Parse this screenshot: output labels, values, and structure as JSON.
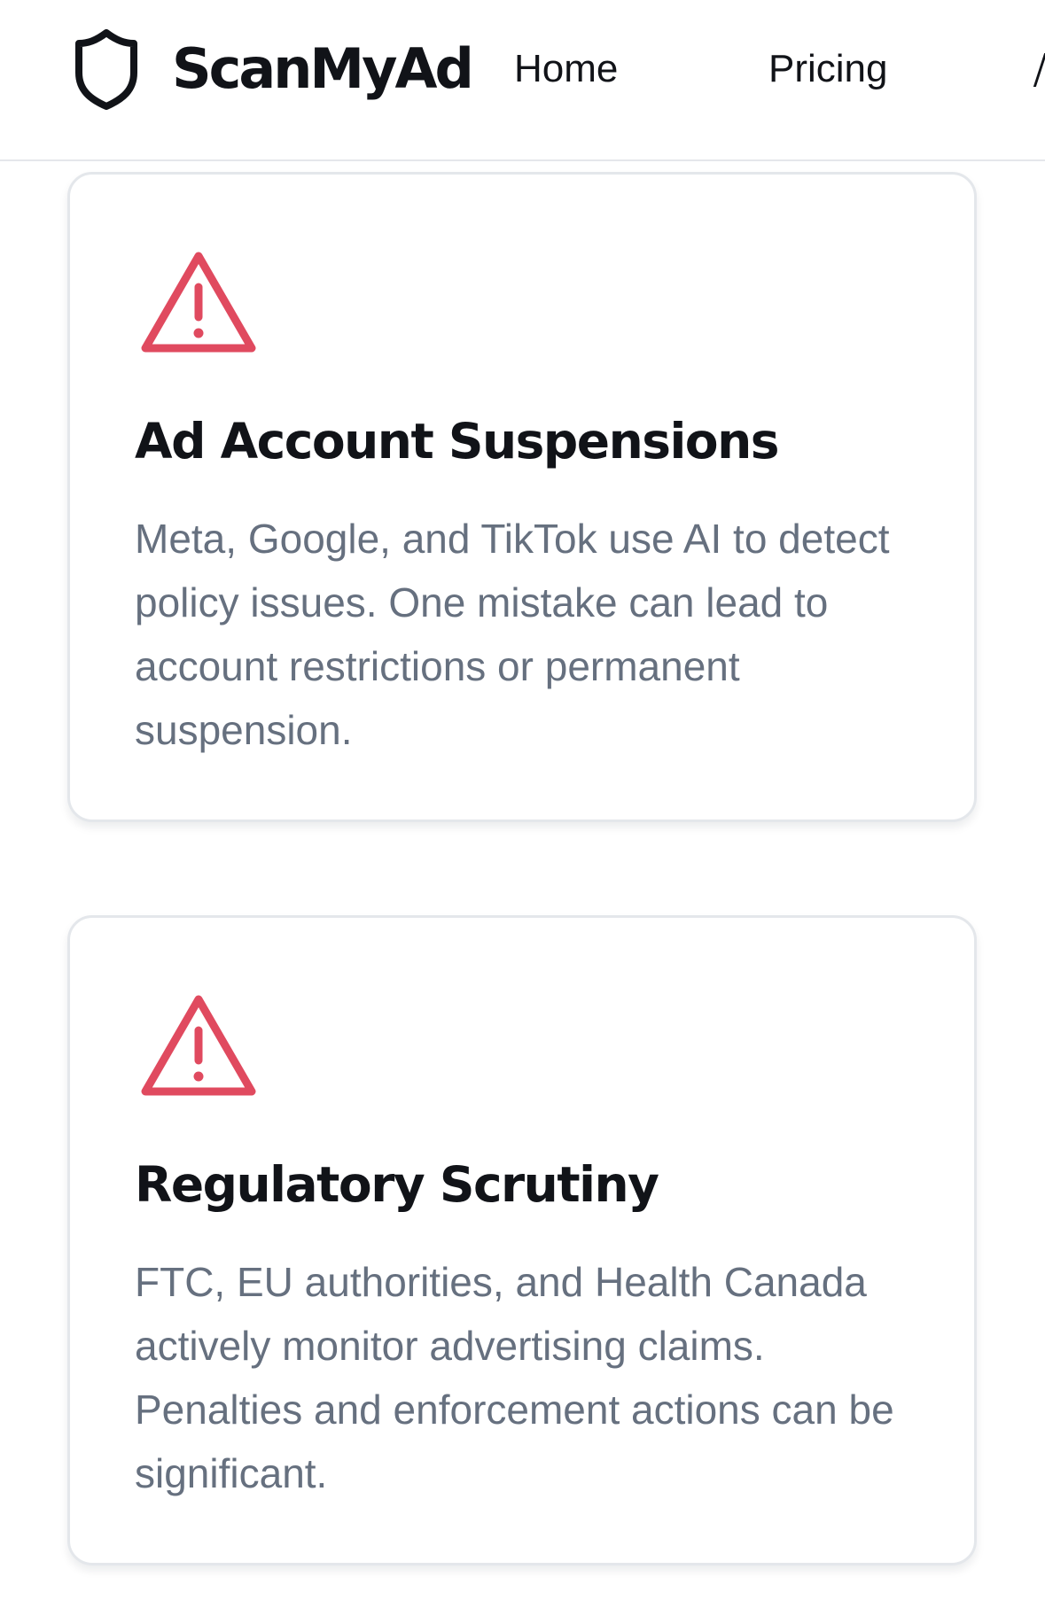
{
  "header": {
    "brand_name": "ScanMyAd",
    "nav": {
      "home": "Home",
      "pricing": "Pricing"
    }
  },
  "cards": [
    {
      "icon": "alert-triangle-icon",
      "title": "Ad Account Suspensions",
      "description": "Meta, Google, and TikTok use AI to detect policy issues. One mistake can lead to account restrictions or permanent suspension."
    },
    {
      "icon": "alert-triangle-icon",
      "title": "Regulatory Scrutiny",
      "description": "FTC, EU authorities, and Health Canada actively monitor advertising claims. Penalties and enforcement actions can be significant."
    }
  ],
  "colors": {
    "text_primary": "#111318",
    "text_muted": "#66707f",
    "alert_red": "#e04a5f",
    "card_border": "#e4e7eb"
  }
}
